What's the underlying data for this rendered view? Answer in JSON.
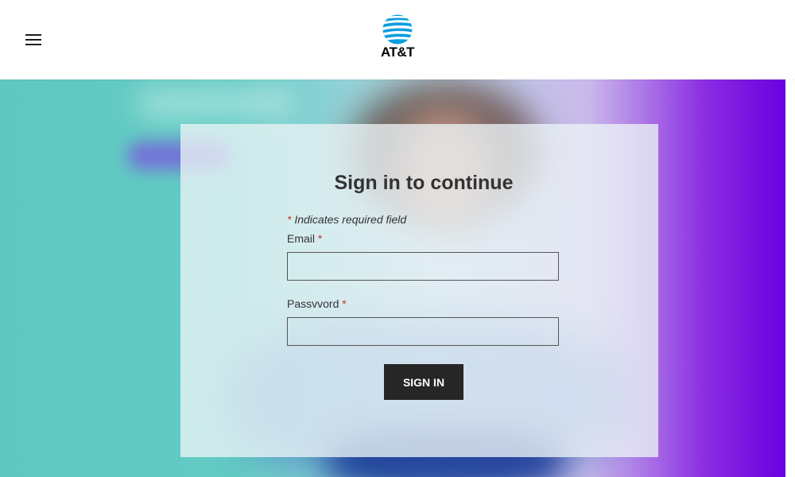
{
  "header": {
    "brand": "AT&T",
    "menu_icon": "hamburger-menu-icon",
    "logo_icon": "att-globe-icon"
  },
  "form": {
    "title": "Sign in to continue",
    "required_star": "*",
    "required_note": "Indicates required field",
    "email_label": "Email",
    "email_value": "",
    "password_label": "Passvvord",
    "password_value": "",
    "submit_label": "SIGN IN"
  },
  "colors": {
    "button_bg": "#262626",
    "required_star": "#c0392b",
    "logo_blue": "#0a9ee0"
  }
}
